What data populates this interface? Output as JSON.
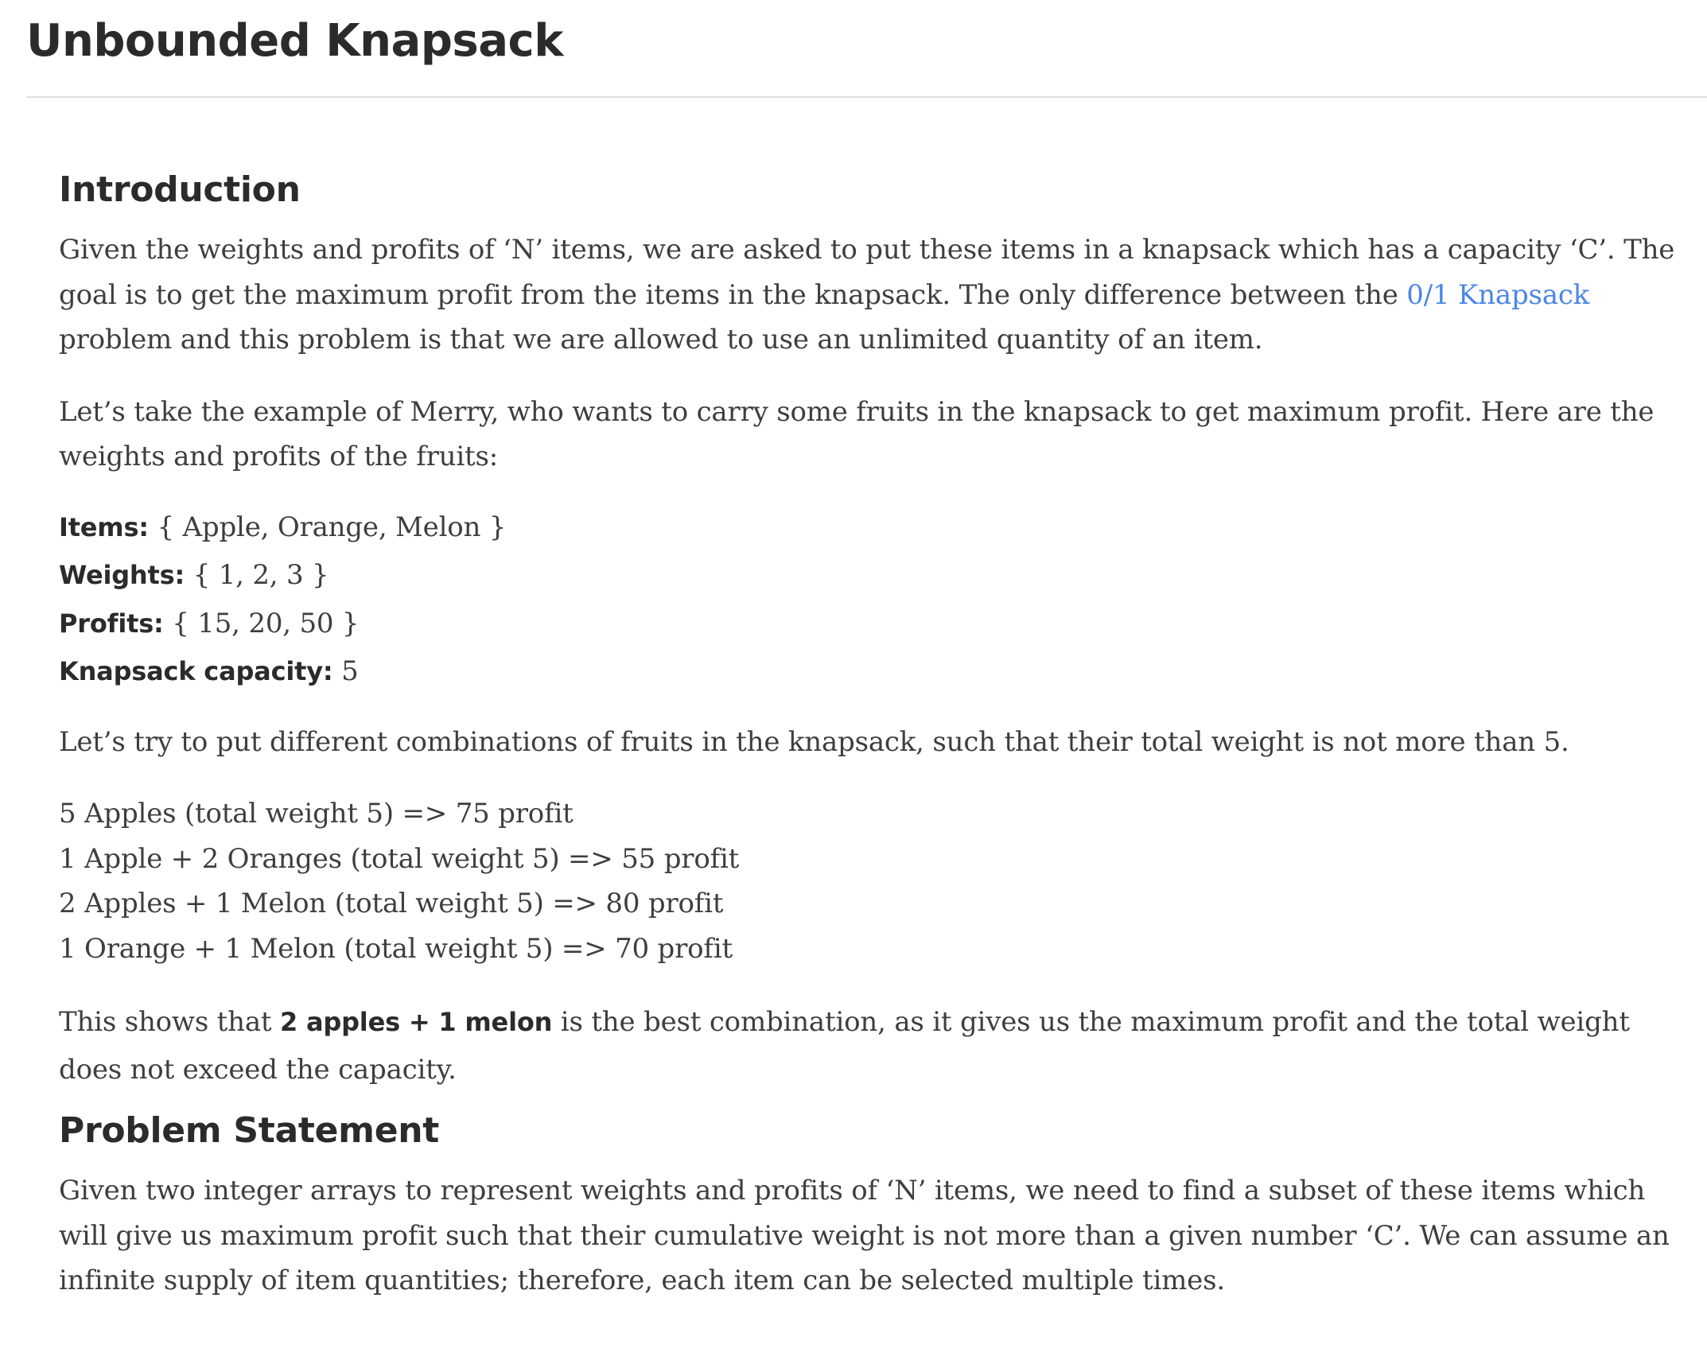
{
  "page": {
    "title": "Unbounded Knapsack"
  },
  "introduction": {
    "heading": "Introduction",
    "p1_before_link": "Given the weights and profits of ‘N’ items, we are asked to put these items in a knapsack which has a capacity ‘C’. The goal is to get the maximum profit from the items in the knapsack. The only difference between the ",
    "p1_link": "0/1 Knapsack",
    "p1_after_link": " problem and this problem is that we are allowed to use an unlimited quantity of an item.",
    "p2": "Let’s take the example of Merry, who wants to carry some fruits in the knapsack to get maximum profit. Here are the weights and profits of the fruits:",
    "items_label": "Items:",
    "items_value": " { Apple, Orange, Melon }",
    "weights_label": "Weights:",
    "weights_value": " { 1, 2, 3 }",
    "profits_label": "Profits:",
    "profits_value": " { 15, 20, 50 }",
    "capacity_label": "Knapsack capacity:",
    "capacity_value": " 5",
    "p3": "Let’s try to put different combinations of fruits in the knapsack, such that their total weight is not more than 5.",
    "combinations": [
      "5 Apples (total weight 5) => 75 profit",
      "1 Apple + 2 Oranges (total weight 5) => 55 profit",
      "2 Apples + 1 Melon (total weight 5) => 80 profit",
      "1 Orange + 1 Melon (total weight 5) => 70 profit"
    ],
    "p4_before": "This shows that ",
    "p4_strong": "2 apples + 1 melon",
    "p4_after": " is the best combination, as it gives us the maximum profit and the total weight does not exceed the capacity."
  },
  "problem_statement": {
    "heading": "Problem Statement",
    "text": "Given two integer arrays to represent weights and profits of ‘N’ items, we need to find a subset of these items which will give us maximum profit such that their cumulative weight is not more than a given number ‘C’. We can assume an infinite supply of item quantities; therefore, each item can be selected multiple times."
  }
}
